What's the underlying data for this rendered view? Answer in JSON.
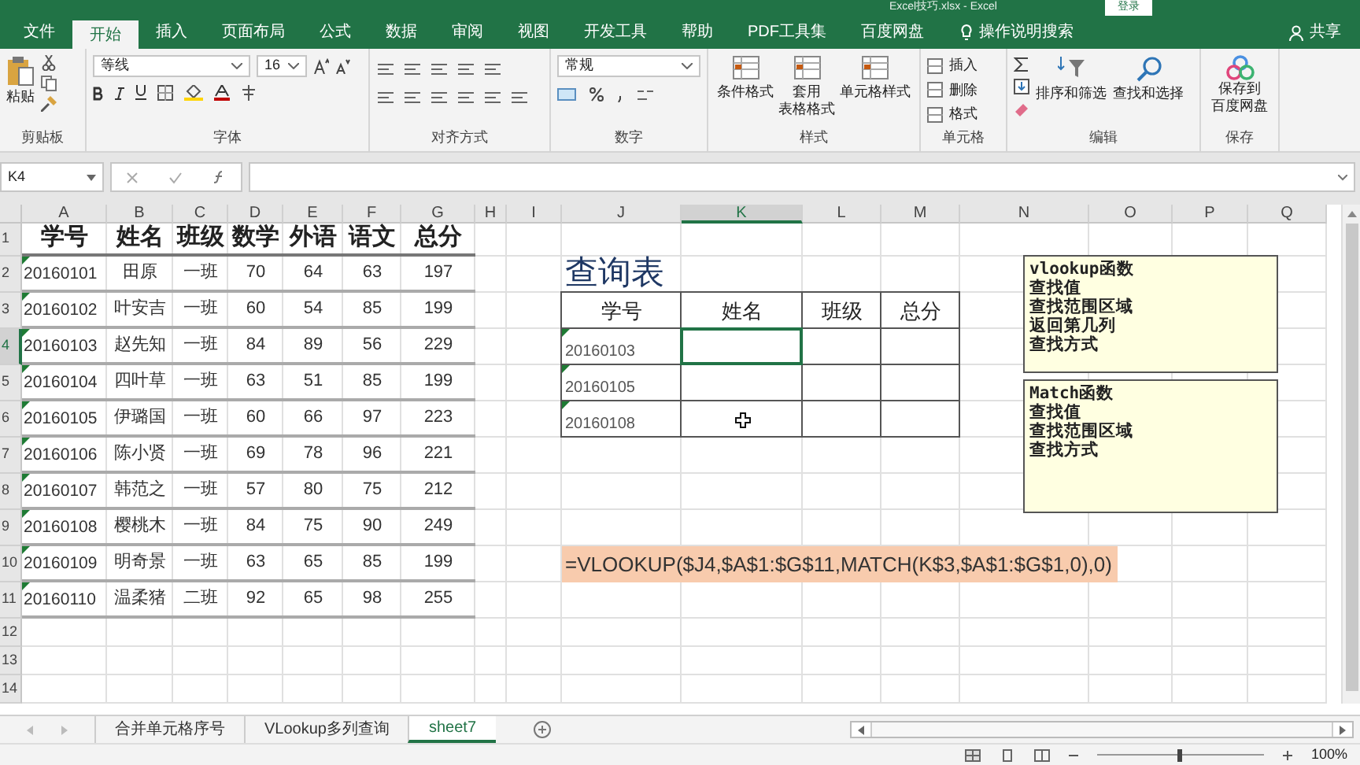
{
  "title_bar": {
    "title": "Excel技巧.xlsx - Excel",
    "login": "登录"
  },
  "menu_tabs": [
    {
      "label": "文件",
      "selected": false
    },
    {
      "label": "开始",
      "selected": true
    },
    {
      "label": "插入",
      "selected": false
    },
    {
      "label": "页面布局",
      "selected": false
    },
    {
      "label": "公式",
      "selected": false
    },
    {
      "label": "数据",
      "selected": false
    },
    {
      "label": "审阅",
      "selected": false
    },
    {
      "label": "视图",
      "selected": false
    },
    {
      "label": "开发工具",
      "selected": false
    },
    {
      "label": "帮助",
      "selected": false
    },
    {
      "label": "PDF工具集",
      "selected": false
    },
    {
      "label": "百度网盘",
      "selected": false
    }
  ],
  "tell_me": "操作说明搜索",
  "share": "共享",
  "ribbon": {
    "clipboard": {
      "paste": "粘贴",
      "group": "剪贴板"
    },
    "font": {
      "name": "等线",
      "size": "16",
      "group": "字体"
    },
    "alignment": {
      "group": "对齐方式"
    },
    "number": {
      "format": "常规",
      "group": "数字"
    },
    "styles": {
      "buttons": [
        [
          "条件格式"
        ],
        [
          "套用",
          "表格格式"
        ],
        [
          "单元格样式"
        ]
      ],
      "group": "样式"
    },
    "cells": {
      "buttons": [
        "插入",
        "删除",
        "格式"
      ],
      "group": "单元格"
    },
    "editing": {
      "buttons": [
        "排序和筛选",
        "查找和选择"
      ],
      "group": "编辑"
    },
    "save": {
      "button": [
        "保存到",
        "百度网盘"
      ],
      "group": "保存"
    }
  },
  "name_box": "K4",
  "columns": [
    {
      "label": "A",
      "selected": false
    },
    {
      "label": "B",
      "selected": false
    },
    {
      "label": "C",
      "selected": false
    },
    {
      "label": "D",
      "selected": false
    },
    {
      "label": "E",
      "selected": false
    },
    {
      "label": "F",
      "selected": false
    },
    {
      "label": "G",
      "selected": false
    },
    {
      "label": "H",
      "selected": false
    },
    {
      "label": "I",
      "selected": false
    },
    {
      "label": "J",
      "selected": false
    },
    {
      "label": "K",
      "selected": true
    },
    {
      "label": "L",
      "selected": false
    },
    {
      "label": "M",
      "selected": false
    },
    {
      "label": "N",
      "selected": false
    },
    {
      "label": "O",
      "selected": false
    },
    {
      "label": "P",
      "selected": false
    },
    {
      "label": "Q",
      "selected": false
    }
  ],
  "rows": [
    {
      "label": "1",
      "selected": false
    },
    {
      "label": "2",
      "selected": false
    },
    {
      "label": "3",
      "selected": false
    },
    {
      "label": "4",
      "selected": true
    },
    {
      "label": "5",
      "selected": false
    },
    {
      "label": "6",
      "selected": false
    },
    {
      "label": "7",
      "selected": false
    },
    {
      "label": "8",
      "selected": false
    },
    {
      "label": "9",
      "selected": false
    },
    {
      "label": "10",
      "selected": false
    },
    {
      "label": "11",
      "selected": false
    },
    {
      "label": "12",
      "selected": false
    },
    {
      "label": "13",
      "selected": false
    },
    {
      "label": "14",
      "selected": false
    }
  ],
  "data_table": {
    "header": [
      "学号",
      "姓名",
      "班级",
      "数学",
      "外语",
      "语文",
      "总分"
    ],
    "rows": [
      [
        "20160101",
        "田原",
        "一班",
        "70",
        "64",
        "63",
        "197"
      ],
      [
        "20160102",
        "叶安吉",
        "一班",
        "60",
        "54",
        "85",
        "199"
      ],
      [
        "20160103",
        "赵先知",
        "一班",
        "84",
        "89",
        "56",
        "229"
      ],
      [
        "20160104",
        "四叶草",
        "一班",
        "63",
        "51",
        "85",
        "199"
      ],
      [
        "20160105",
        "伊璐国",
        "一班",
        "60",
        "66",
        "97",
        "223"
      ],
      [
        "20160106",
        "陈小贤",
        "一班",
        "69",
        "78",
        "96",
        "221"
      ],
      [
        "20160107",
        "韩范之",
        "一班",
        "57",
        "80",
        "75",
        "212"
      ],
      [
        "20160108",
        "樱桃木",
        "一班",
        "84",
        "75",
        "90",
        "249"
      ],
      [
        "20160109",
        "明奇景",
        "一班",
        "63",
        "65",
        "85",
        "199"
      ],
      [
        "20160110",
        "温柔猪",
        "二班",
        "92",
        "65",
        "98",
        "255"
      ]
    ]
  },
  "query": {
    "title": "查询表",
    "header": [
      "学号",
      "姓名",
      "班级",
      "总分"
    ],
    "ids": [
      "20160103",
      "20160105",
      "20160108"
    ]
  },
  "notes": [
    {
      "lines": [
        "vlookup函数",
        "查找值",
        "查找范围区域",
        "返回第几列",
        "查找方式"
      ]
    },
    {
      "lines": [
        "Match函数",
        "查找值",
        "查找范围区域",
        "查找方式"
      ]
    }
  ],
  "formula_text": "=VLOOKUP($J4,$A$1:$G$11,MATCH(K$3,$A$1:$G$1,0),0)",
  "sheet_tabs": [
    {
      "label": "合并单元格序号",
      "selected": false
    },
    {
      "label": "VLookup多列查询",
      "selected": false
    },
    {
      "label": "sheet7",
      "selected": true
    }
  ],
  "status": {
    "zoom": "100%",
    "zoom_slider": {
      "level": 0.5
    }
  }
}
